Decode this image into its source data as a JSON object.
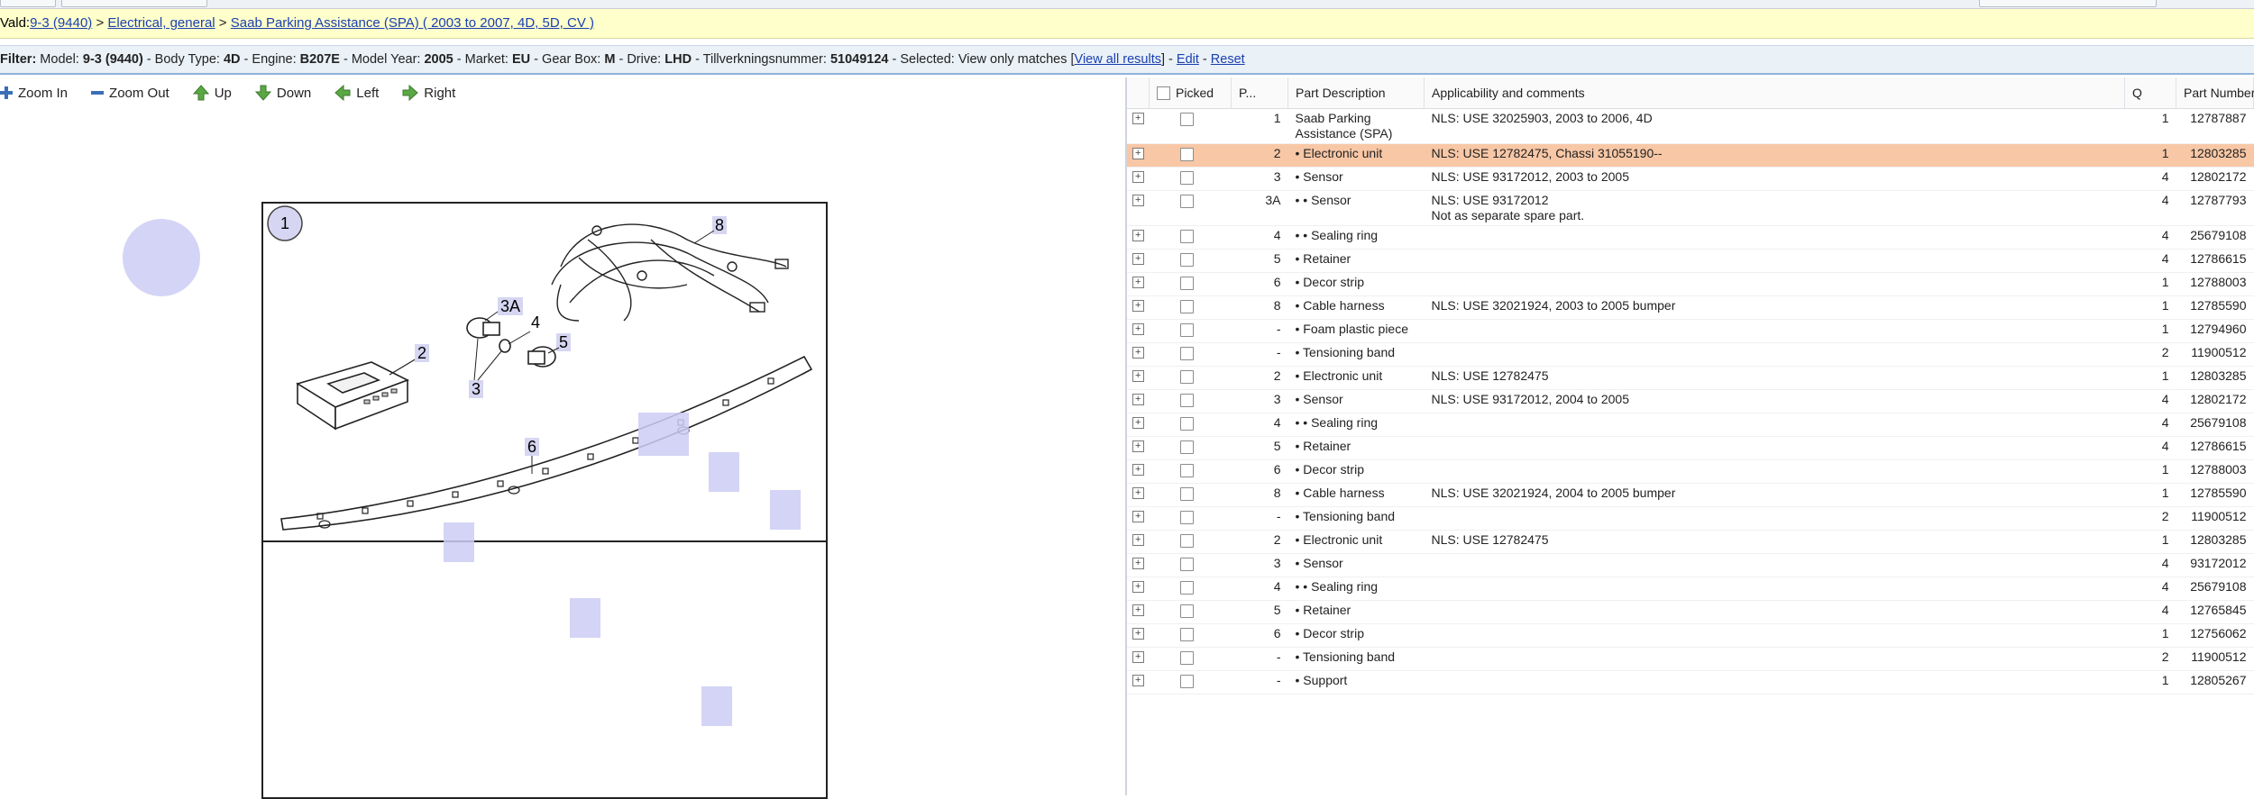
{
  "breadcrumb": {
    "prefix": "Vald:",
    "items": [
      "9-3 (9440)",
      "Electrical, general",
      "Saab Parking Assistance (SPA) ( 2003 to 2007, 4D, 5D, CV )"
    ],
    "sep": " > "
  },
  "filter": {
    "label": "Filter:",
    "segments": [
      {
        "k": " Model: ",
        "v": "9-3 (9440)"
      },
      {
        "k": " - Body Type: ",
        "v": "4D"
      },
      {
        "k": " - Engine: ",
        "v": "B207E"
      },
      {
        "k": " - Model Year: ",
        "v": "2005"
      },
      {
        "k": " - Market: ",
        "v": "EU"
      },
      {
        "k": " - Gear Box: ",
        "v": "M"
      },
      {
        "k": " - Drive: ",
        "v": "LHD"
      },
      {
        "k": " - Tillverkningsnummer: ",
        "v": "51049124"
      },
      {
        "k": " - Selected: ",
        "v": ""
      }
    ],
    "selected_text": "View only matches ",
    "view_all": "View all results",
    "edit": "Edit",
    "reset": "Reset"
  },
  "toolbar": {
    "zoom_in": "Zoom In",
    "zoom_out": "Zoom Out",
    "up": "Up",
    "down": "Down",
    "left": "Left",
    "right": "Right"
  },
  "diagram": {
    "callouts": [
      "1",
      "2",
      "3A",
      "4",
      "5",
      "3",
      "6",
      "8"
    ]
  },
  "table": {
    "headers": {
      "picked": "Picked",
      "pos": "P...",
      "desc": "Part Description",
      "app": "Applicability and comments",
      "q": "Q",
      "pn": "Part Number"
    },
    "rows": [
      {
        "pos": "1",
        "desc": "Saab Parking Assistance (SPA)",
        "app": "NLS: USE 32025903, 2003 to 2006, 4D",
        "q": "1",
        "pn": "12787887"
      },
      {
        "pos": "2",
        "desc": "• Electronic unit",
        "app": "NLS: USE 12782475, Chassi 31055190--",
        "q": "1",
        "pn": "12803285",
        "hl": true
      },
      {
        "pos": "3",
        "desc": "• Sensor",
        "app": "NLS: USE 93172012, 2003 to 2005",
        "q": "4",
        "pn": "12802172"
      },
      {
        "pos": "3A",
        "desc": "• • Sensor",
        "app": "NLS: USE 93172012",
        "app2": "Not as separate spare part.",
        "q": "4",
        "pn": "12787793"
      },
      {
        "pos": "4",
        "desc": "• • Sealing ring",
        "app": "",
        "q": "4",
        "pn": "25679108"
      },
      {
        "pos": "5",
        "desc": "• Retainer",
        "app": "",
        "q": "4",
        "pn": "12786615"
      },
      {
        "pos": "6",
        "desc": "• Decor strip",
        "app": "",
        "q": "1",
        "pn": "12788003"
      },
      {
        "pos": "8",
        "desc": "• Cable harness",
        "app": "NLS: USE 32021924, 2003 to 2005 bumper",
        "q": "1",
        "pn": "12785590"
      },
      {
        "pos": "-",
        "desc": "• Foam plastic piece",
        "app": "",
        "q": "1",
        "pn": "12794960"
      },
      {
        "pos": "-",
        "desc": "• Tensioning band",
        "app": "",
        "q": "2",
        "pn": "11900512"
      },
      {
        "pos": "2",
        "desc": "• Electronic unit",
        "app": "NLS: USE 12782475",
        "q": "1",
        "pn": "12803285"
      },
      {
        "pos": "3",
        "desc": "• Sensor",
        "app": "NLS: USE 93172012, 2004 to 2005",
        "q": "4",
        "pn": "12802172"
      },
      {
        "pos": "4",
        "desc": "• • Sealing ring",
        "app": "",
        "q": "4",
        "pn": "25679108"
      },
      {
        "pos": "5",
        "desc": "• Retainer",
        "app": "",
        "q": "4",
        "pn": "12786615"
      },
      {
        "pos": "6",
        "desc": "• Decor strip",
        "app": "",
        "q": "1",
        "pn": "12788003"
      },
      {
        "pos": "8",
        "desc": "• Cable harness",
        "app": "NLS: USE 32021924, 2004 to 2005 bumper",
        "q": "1",
        "pn": "12785590"
      },
      {
        "pos": "-",
        "desc": "• Tensioning band",
        "app": "",
        "q": "2",
        "pn": "11900512"
      },
      {
        "pos": "2",
        "desc": "• Electronic unit",
        "app": "NLS: USE 12782475",
        "q": "1",
        "pn": "12803285"
      },
      {
        "pos": "3",
        "desc": "• Sensor",
        "app": "",
        "q": "4",
        "pn": "93172012"
      },
      {
        "pos": "4",
        "desc": "• • Sealing ring",
        "app": "",
        "q": "4",
        "pn": "25679108"
      },
      {
        "pos": "5",
        "desc": "• Retainer",
        "app": "",
        "q": "4",
        "pn": "12765845"
      },
      {
        "pos": "6",
        "desc": "• Decor strip",
        "app": "",
        "q": "1",
        "pn": "12756062"
      },
      {
        "pos": "-",
        "desc": "• Tensioning band",
        "app": "",
        "q": "2",
        "pn": "11900512"
      },
      {
        "pos": "-",
        "desc": "• Support",
        "app": "",
        "q": "1",
        "pn": "12805267"
      }
    ]
  },
  "colors": {
    "highlight_row": "#f8c7a5",
    "breadcrumb_bg": "#ffffcc",
    "filter_bg": "#eaf1f7",
    "hotspot": "#cdcdf5",
    "link": "#1a3fb0"
  }
}
